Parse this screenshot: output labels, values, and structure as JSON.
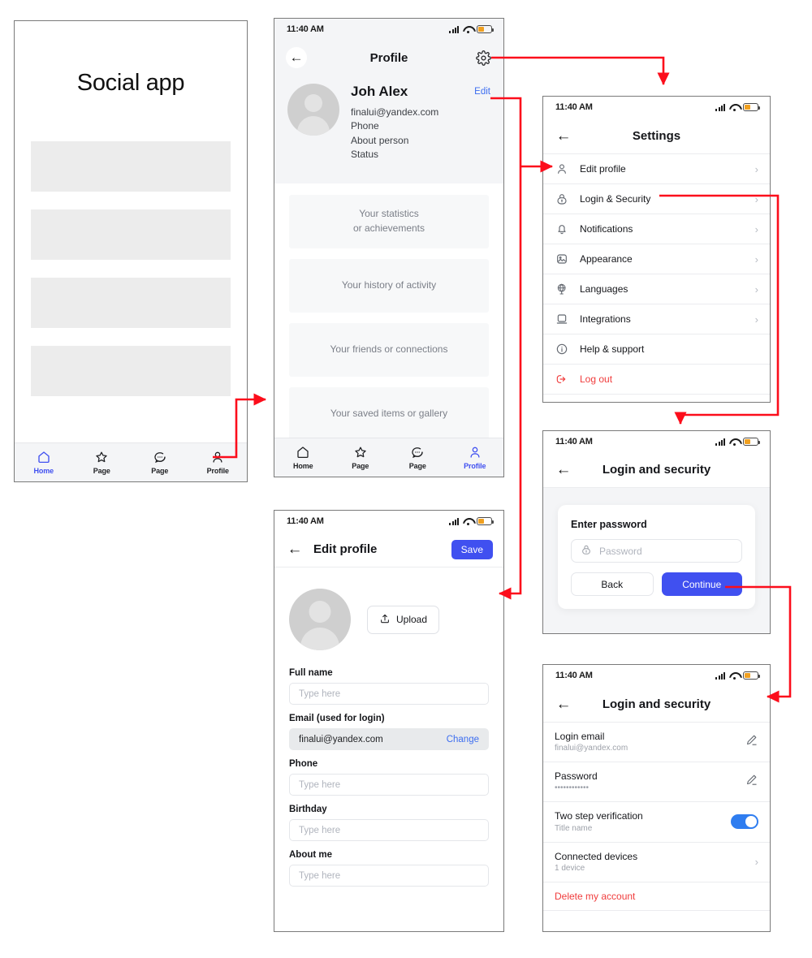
{
  "colors": {
    "accent": "#4050f0",
    "link": "#3d6ef0",
    "danger": "#f03c3c",
    "toggle_on": "#2f7df0",
    "arrow": "#fc0d1b"
  },
  "status_bar": {
    "time": "11:40 AM",
    "signal_icon": "signal-bars-icon",
    "wifi_icon": "wifi-icon",
    "battery_icon": "battery-icon"
  },
  "screen1": {
    "title": "Social app",
    "placeholder_blocks": 4,
    "tabs": [
      {
        "label": "Home",
        "icon": "home-icon",
        "active": true
      },
      {
        "label": "Page",
        "icon": "star-icon",
        "active": false
      },
      {
        "label": "Page",
        "icon": "chat-bubble-icon",
        "active": false
      },
      {
        "label": "Profile",
        "icon": "person-icon",
        "active": false
      }
    ]
  },
  "screen2": {
    "appbar": {
      "title": "Profile",
      "back_icon": "back-arrow-icon",
      "settings_icon": "gear-icon"
    },
    "profile": {
      "avatar_icon": "avatar-placeholder-icon",
      "name": "Joh Alex",
      "email": "finalui@yandex.com",
      "phone": "Phone",
      "about": "About person",
      "status": "Status",
      "edit_label": "Edit"
    },
    "cards": [
      "Your statistics\nor achievements",
      "Your history of activity",
      "Your friends or connections",
      "Your saved items or gallery"
    ],
    "tabs": [
      {
        "label": "Home",
        "icon": "home-icon",
        "active": false
      },
      {
        "label": "Page",
        "icon": "star-icon",
        "active": false
      },
      {
        "label": "Page",
        "icon": "chat-bubble-icon",
        "active": false
      },
      {
        "label": "Profile",
        "icon": "person-icon",
        "active": true
      }
    ]
  },
  "screen3": {
    "appbar": {
      "title": "Settings",
      "back_icon": "back-arrow-icon"
    },
    "items": [
      {
        "label": "Edit profile",
        "icon": "person-icon",
        "chevron": true,
        "danger": false
      },
      {
        "label": "Login & Security",
        "icon": "lock-icon",
        "chevron": true,
        "danger": false
      },
      {
        "label": "Notifications",
        "icon": "bell-icon",
        "chevron": true,
        "danger": false
      },
      {
        "label": "Appearance",
        "icon": "image-icon",
        "chevron": true,
        "danger": false
      },
      {
        "label": "Languages",
        "icon": "globe-icon",
        "chevron": true,
        "danger": false
      },
      {
        "label": "Integrations",
        "icon": "laptop-icon",
        "chevron": true,
        "danger": false
      },
      {
        "label": "Help & support",
        "icon": "info-icon",
        "chevron": false,
        "danger": false
      },
      {
        "label": "Log out",
        "icon": "logout-icon",
        "chevron": false,
        "danger": true
      }
    ]
  },
  "screen4": {
    "appbar": {
      "title": "Edit profile",
      "back_icon": "back-arrow-icon",
      "save_label": "Save"
    },
    "avatar_icon": "avatar-placeholder-icon",
    "upload_label": "Upload",
    "upload_icon": "upload-icon",
    "fields": [
      {
        "label": "Full name",
        "value": "",
        "placeholder": "Type here",
        "filled": false,
        "action": ""
      },
      {
        "label": "Email (used for login)",
        "value": "finalui@yandex.com",
        "placeholder": "",
        "filled": true,
        "action": "Change"
      },
      {
        "label": "Phone",
        "value": "",
        "placeholder": "Type here",
        "filled": false,
        "action": ""
      },
      {
        "label": "Birthday",
        "value": "",
        "placeholder": "Type here",
        "filled": false,
        "action": ""
      },
      {
        "label": "About me",
        "value": "",
        "placeholder": "Type here",
        "filled": false,
        "action": ""
      }
    ]
  },
  "screen5": {
    "appbar": {
      "title": "Login and security",
      "back_icon": "back-arrow-icon"
    },
    "modal": {
      "title": "Enter password",
      "password_placeholder": "Password",
      "password_icon": "lock-icon",
      "back_label": "Back",
      "continue_label": "Continue"
    }
  },
  "screen6": {
    "appbar": {
      "title": "Login and security",
      "back_icon": "back-arrow-icon"
    },
    "items": [
      {
        "title": "Login email",
        "sub": "finalui@yandex.com",
        "control": "edit",
        "danger": false
      },
      {
        "title": "Password",
        "sub": "••••••••••••",
        "control": "edit",
        "danger": false
      },
      {
        "title": "Two step verification",
        "sub": "Title name",
        "control": "toggle",
        "danger": false
      },
      {
        "title": "Connected devices",
        "sub": "1 device",
        "control": "chevron",
        "danger": false
      },
      {
        "title": "Delete my account",
        "sub": "",
        "control": "none",
        "danger": true
      }
    ]
  }
}
